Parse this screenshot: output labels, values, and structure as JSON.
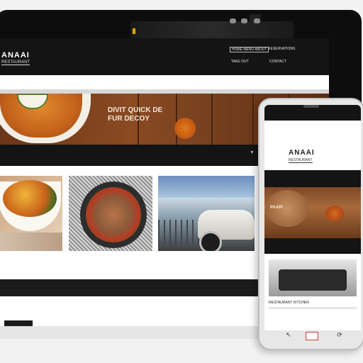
{
  "tablet": {
    "site": {
      "logo": "ANAAI",
      "logo_sub": "RESTAURANT",
      "nav_top": "HOME MENU ABOUT",
      "nav_top_right": "RESERVATIONS",
      "nav_row2_a": "TAKE OUT",
      "nav_row2_b": "CONTACT",
      "hero_line1": "DIVIT QUICK DE",
      "hero_line2": "FUR DECOY"
    }
  },
  "phone": {
    "logo": "ANAAI",
    "logo_sub": "RESTAURANT",
    "hero_text": "PAAPI",
    "caption": "RESTAURANT KITCHEN"
  },
  "icons": {
    "back": "back-icon",
    "home": "home-icon",
    "recent": "recent-icon"
  }
}
